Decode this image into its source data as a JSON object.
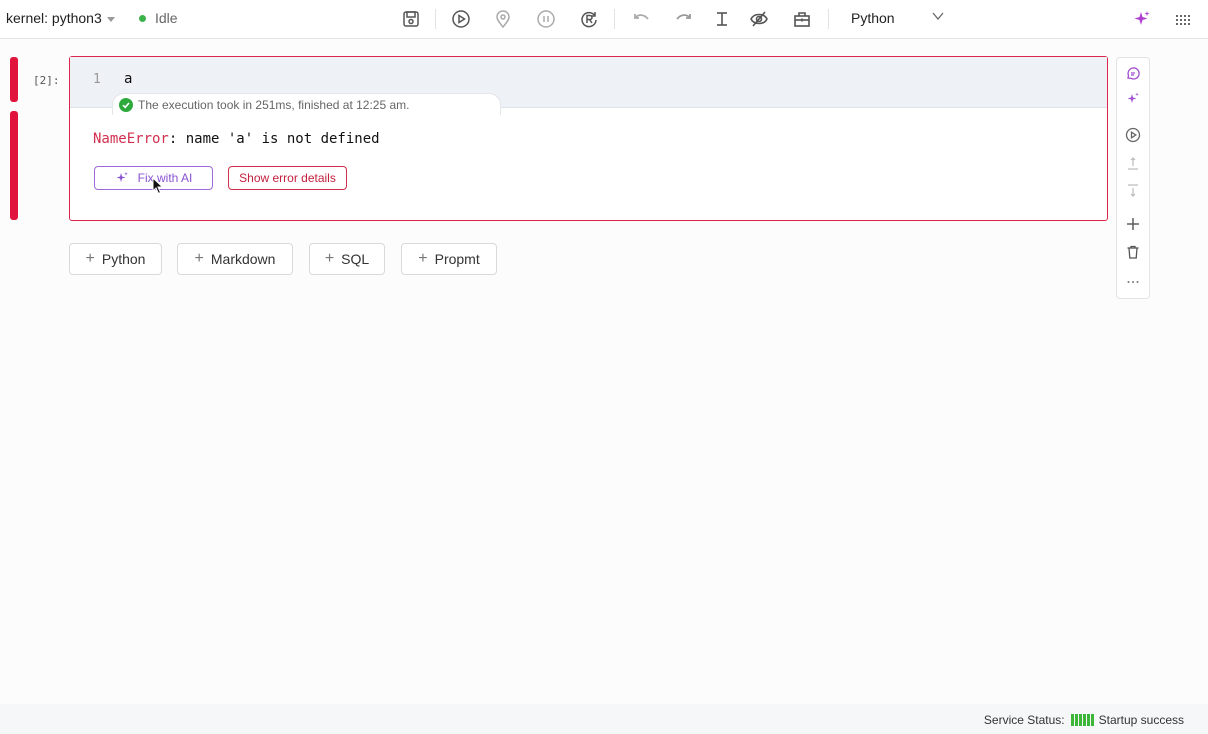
{
  "toolbar": {
    "kernel_label": "kernel:",
    "kernel_name": "python3",
    "kernel_status": "Idle",
    "language": "Python",
    "status_color": "#3cb34a",
    "icons": [
      "save-icon",
      "run-icon",
      "locate-icon",
      "pause-icon",
      "restart-icon",
      "undo-icon",
      "redo-icon",
      "text-cursor-icon",
      "eye-off-icon",
      "toolbox-icon",
      "chevron-down-icon",
      "ai-sparkle-icon",
      "grid-icon"
    ]
  },
  "cell": {
    "prompt": "[2]:",
    "line_number": "1",
    "code": "a",
    "exec_info": "The execution took in 251ms, finished at 12:25 am.",
    "error_type": "NameError",
    "error_message": ": name 'a' is not defined",
    "fix_ai_label": "Fix with AI",
    "show_error_label": "Show error details",
    "accent_color": "#e0143c"
  },
  "add_buttons": {
    "python": "Python",
    "markdown": "Markdown",
    "sql": "SQL",
    "prompt": "Propmt"
  },
  "sidebar_icons": [
    "chat-icon",
    "ai-sparkle-icon",
    "run-icon",
    "move-up-icon",
    "move-down-icon",
    "add-icon",
    "trash-icon",
    "more-icon"
  ],
  "statusbar": {
    "service_label": "Service Status:",
    "service_value": "Startup success",
    "service_color": "#3db53a"
  }
}
